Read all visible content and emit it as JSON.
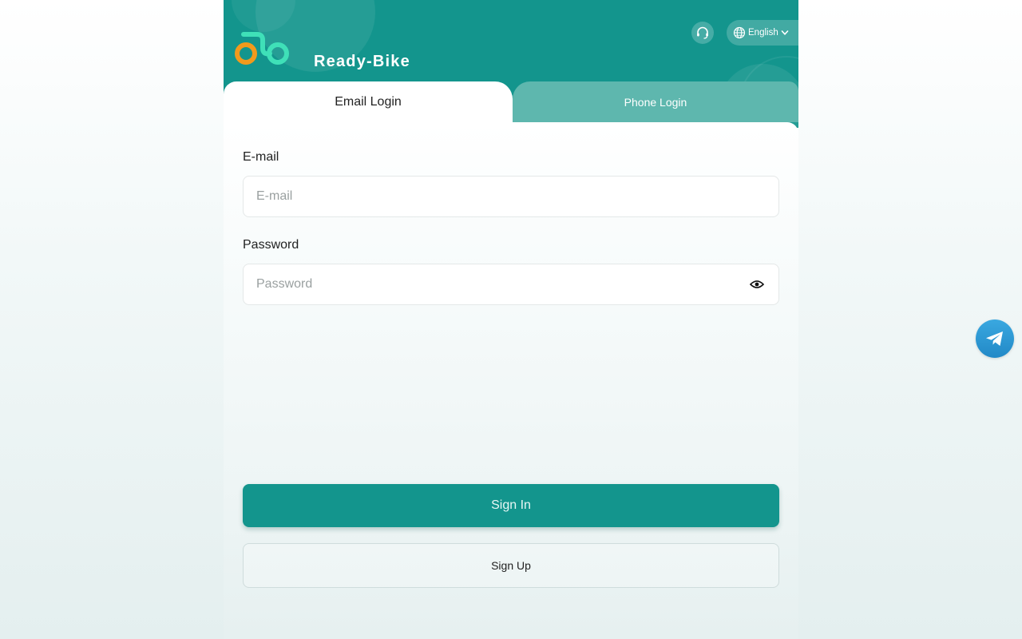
{
  "header": {
    "brand_name": "Ready-Bike",
    "language": {
      "selected": "English"
    },
    "support_icon": "headset-icon",
    "logo_icon": "bike-logo-icon"
  },
  "tabs": [
    {
      "label": "Email Login",
      "active": true
    },
    {
      "label": "Phone Login",
      "active": false
    }
  ],
  "form": {
    "email": {
      "label": "E-mail",
      "placeholder": "E-mail",
      "value": ""
    },
    "password": {
      "label": "Password",
      "placeholder": "Password",
      "value": "",
      "toggle_icon": "eye-icon"
    }
  },
  "actions": {
    "sign_in_label": "Sign In",
    "sign_up_label": "Sign Up"
  },
  "floating": {
    "telegram_icon": "telegram-icon"
  },
  "colors": {
    "primary": "#13958d",
    "inactive_tab": "#5eb7ae",
    "logo_orange": "#f19a1c",
    "logo_green": "#3fe0b8",
    "telegram_blue": "#2a9ad6"
  }
}
